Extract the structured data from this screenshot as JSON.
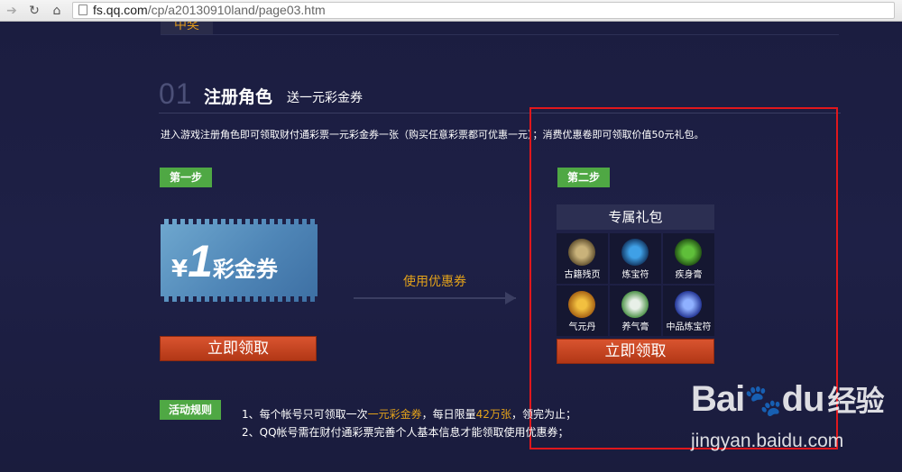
{
  "browser": {
    "url_host": "fs.qq.com",
    "url_path": "/cp/a20130910land/page03.htm"
  },
  "previous_section_tab": "中奖",
  "section": {
    "number": "01",
    "title": "注册角色",
    "subtitle": "送一元彩金券",
    "description": "进入游戏注册角色即可领取财付通彩票一元彩金券一张（购买任意彩票都可优惠一元）；消费优惠卷即可领取价值50元礼包。"
  },
  "step1": {
    "badge": "第一步",
    "coupon": {
      "yen": "¥",
      "amount": "1",
      "word": "彩金券"
    },
    "button": "立即领取"
  },
  "use_coupon_label": "使用优惠券",
  "step2": {
    "badge": "第二步",
    "gift_title": "专属礼包",
    "items": [
      {
        "label": "古籍残页",
        "icon": "scroll-icon",
        "color": "#c9b27a"
      },
      {
        "label": "炼宝符",
        "icon": "talisman-icon",
        "color": "#3fa0e6"
      },
      {
        "label": "疾身膏",
        "icon": "potion-icon",
        "color": "#5fbf3a"
      },
      {
        "label": "气元丹",
        "icon": "pill-icon",
        "color": "#e8a020"
      },
      {
        "label": "养气膏",
        "icon": "jar-icon",
        "color": "#6fd06a"
      },
      {
        "label": "中品炼宝符",
        "icon": "rune-icon",
        "color": "#5a7ee8"
      }
    ],
    "button": "立即领取"
  },
  "rules": {
    "badge": "活动规则",
    "line1": {
      "prefix": "1、每个帐号只可领取一次",
      "hl1": "一元彩金券",
      "mid": "，每日限量",
      "hl2": "42万张",
      "suffix": "，领完为止；"
    },
    "line2": "2、QQ帐号需在财付通彩票完善个人基本信息才能领取使用优惠券；"
  },
  "watermark": {
    "logo": "Bai",
    "logo_tail": "du",
    "logo_cn": "经验",
    "url": "jingyan.baidu.com"
  }
}
